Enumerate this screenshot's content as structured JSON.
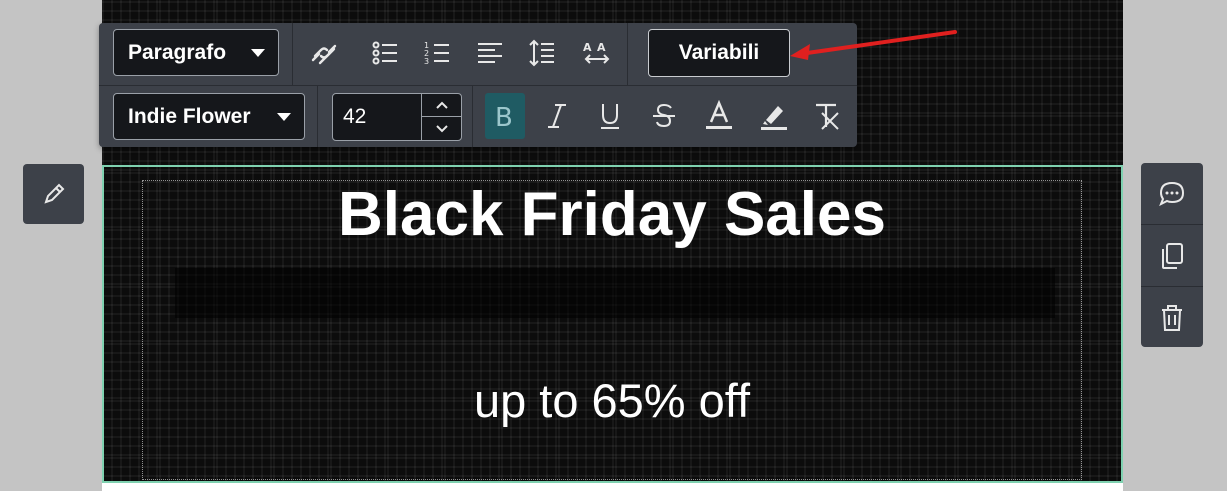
{
  "toolbar": {
    "paragraph_select": "Paragrafo",
    "font_select": "Indie Flower",
    "font_size": "42",
    "variables_button": "Variabili",
    "tools_row1": [
      "unlink-icon",
      "bulleted-list-icon",
      "numbered-list-icon",
      "align-left-icon",
      "line-height-icon",
      "text-direction-icon"
    ],
    "tools_row2": [
      "bold-icon",
      "italic-icon",
      "underline-icon",
      "strikethrough-icon",
      "font-color-icon",
      "highlight-icon",
      "clear-format-icon"
    ],
    "active_tool": "bold-icon"
  },
  "content": {
    "headline": "Black Friday Sales",
    "subline": "up to 65% off"
  },
  "side_actions": {
    "left": [
      "pencil-icon"
    ],
    "right": [
      "comment-icon",
      "duplicate-icon",
      "trash-icon"
    ]
  },
  "colors": {
    "toolbar_bg": "#3d4149",
    "selection_border": "#7fd1b0",
    "active_bold_bg": "#1f5b63",
    "annotation_arrow": "#e0201f"
  }
}
